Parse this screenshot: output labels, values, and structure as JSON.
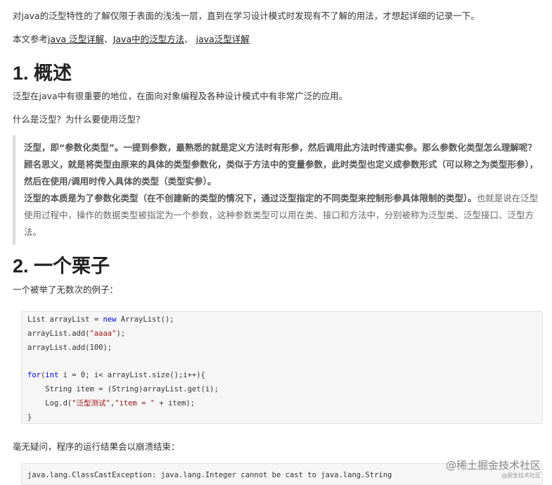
{
  "intro": "对java的泛型特性的了解仅限于表面的浅浅一层，直到在学习设计模式时发现有不了解的用法，才想起详细的记录一下。",
  "refs": {
    "prefix": "本文参考",
    "link1": "java 泛型详解",
    "sep1": "、",
    "link2": "Java中的泛型方法",
    "sep2": "、 ",
    "link3": "java泛型详解"
  },
  "section1": {
    "title": "1. 概述",
    "para1": "泛型在java中有很重要的地位，在面向对象编程及各种设计模式中有非常广泛的应用。",
    "para2": "什么是泛型？为什么要使用泛型？",
    "quote_bold1": "泛型，即“参数化类型”。一提到参数，最熟悉的就是定义方法时有形参，然后调用此方法时传递实参。那么参数化类型怎么理解呢？顾名思义，就是将类型由原来的具体的类型参数化，类似于方法中的变量参数，此时类型也定义成参数形式（可以称之为类型形参），然后在使用/调用时传入具体的类型（类型实参）。",
    "quote_bold2": "泛型的本质是为了参数化类型（在不创建新的类型的情况下，通过泛型指定的不同类型来控制形参具体限制的类型）。",
    "quote_normal": "也就是说在泛型使用过程中，操作的数据类型被指定为一个参数，这种参数类型可以用在类、接口和方法中，分别被称为泛型类、泛型接口、泛型方法。"
  },
  "section2": {
    "title": "2. 一个栗子",
    "para1": "一个被举了无数次的例子：",
    "code": {
      "l1a": "List arrayList = ",
      "l1kw": "new",
      "l1b": " ArrayList();",
      "l2a": "arrayList.add(",
      "l2s": "\"aaaa\"",
      "l2b": ");",
      "l3": "arrayList.add(100);",
      "l5kw1": "for",
      "l5a": "(",
      "l5kw2": "int",
      "l5b": " i = 0; i< arrayList.size();i++){",
      "l6": "    String item = (String)arrayList.get(i);",
      "l7a": "    Log.d(",
      "l7s1": "\"泛型测试\"",
      "l7b": ",",
      "l7s2": "\"item = \"",
      "l7c": " + item);",
      "l8": "}"
    },
    "para2": "毫无疑问，程序的运行结果会以崩溃结束：",
    "exception": "java.lang.ClassCastException: java.lang.Integer cannot be cast to java.lang.String"
  },
  "watermark": {
    "main": "@稀土掘金技术社区",
    "sub": "@掘金技术社区"
  }
}
